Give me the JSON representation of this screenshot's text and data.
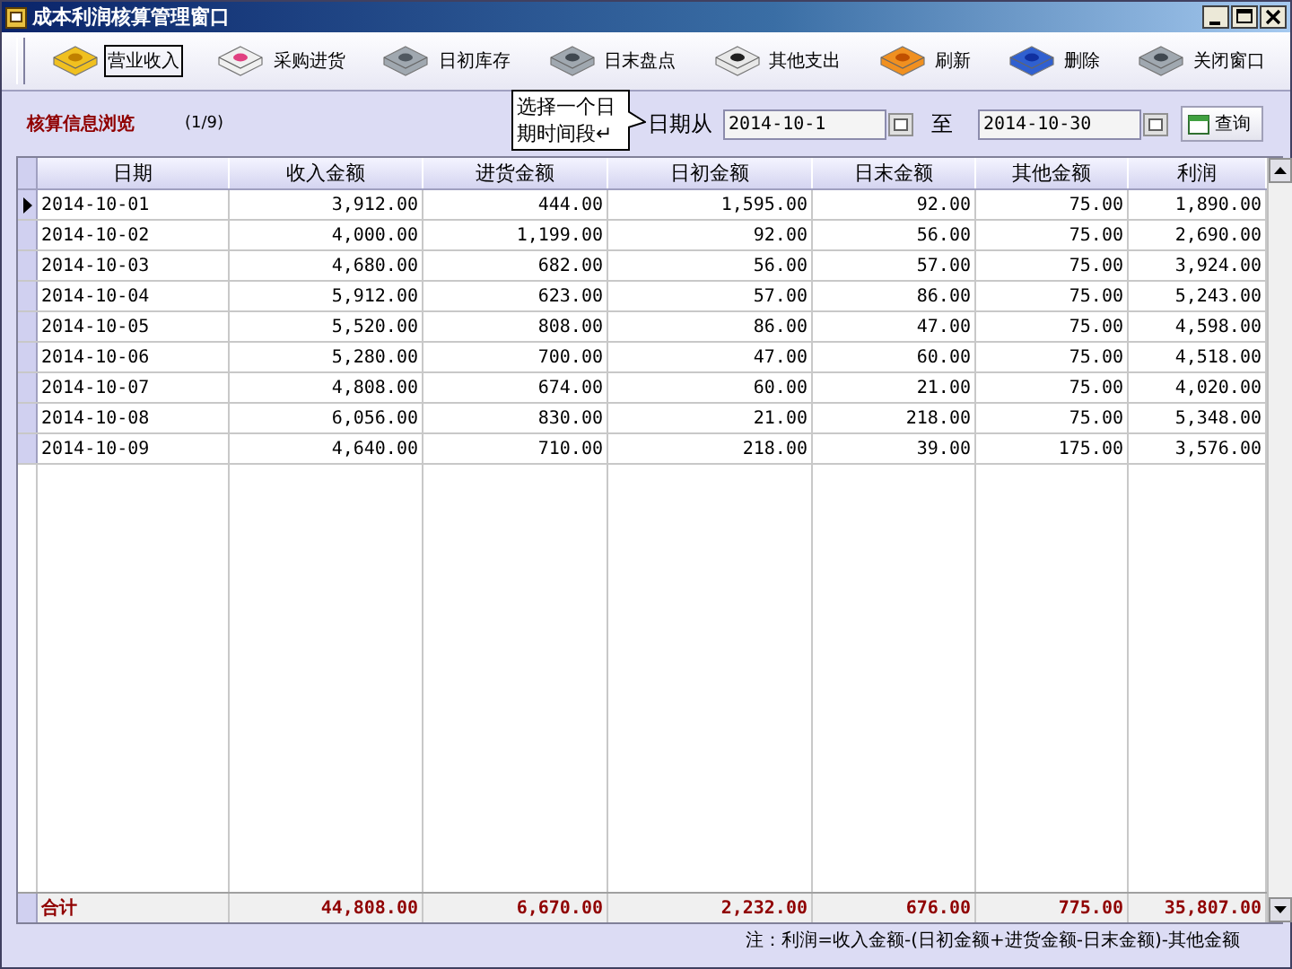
{
  "window": {
    "title": "成本利润核算管理窗口"
  },
  "toolbar": [
    {
      "label": "营业收入",
      "selected": true
    },
    {
      "label": "采购进货",
      "selected": false
    },
    {
      "label": "日初库存",
      "selected": false
    },
    {
      "label": "日末盘点",
      "selected": false
    },
    {
      "label": "其他支出",
      "selected": false
    },
    {
      "label": "刷新",
      "selected": false
    },
    {
      "label": "删除",
      "selected": false
    },
    {
      "label": "关闭窗口",
      "selected": false
    }
  ],
  "info_bar": {
    "title": "核算信息浏览",
    "page": "(1/9)",
    "callout": "选择一个日期时间段↵",
    "date_from_label": "日期从",
    "date_from": "2014-10-1",
    "date_to_label": "至",
    "date_to": "2014-10-30",
    "query_button": "查询"
  },
  "table": {
    "columns": [
      "日期",
      "收入金额",
      "进货金额",
      "日初金额",
      "日末金额",
      "其他金额",
      "利润"
    ],
    "rows": [
      {
        "selected": true,
        "cells": [
          "2014-10-01",
          "3,912.00",
          "444.00",
          "1,595.00",
          "92.00",
          "75.00",
          "1,890.00"
        ]
      },
      {
        "selected": false,
        "cells": [
          "2014-10-02",
          "4,000.00",
          "1,199.00",
          "92.00",
          "56.00",
          "75.00",
          "2,690.00"
        ]
      },
      {
        "selected": false,
        "cells": [
          "2014-10-03",
          "4,680.00",
          "682.00",
          "56.00",
          "57.00",
          "75.00",
          "3,924.00"
        ]
      },
      {
        "selected": false,
        "cells": [
          "2014-10-04",
          "5,912.00",
          "623.00",
          "57.00",
          "86.00",
          "75.00",
          "5,243.00"
        ]
      },
      {
        "selected": false,
        "cells": [
          "2014-10-05",
          "5,520.00",
          "808.00",
          "86.00",
          "47.00",
          "75.00",
          "4,598.00"
        ]
      },
      {
        "selected": false,
        "cells": [
          "2014-10-06",
          "5,280.00",
          "700.00",
          "47.00",
          "60.00",
          "75.00",
          "4,518.00"
        ]
      },
      {
        "selected": false,
        "cells": [
          "2014-10-07",
          "4,808.00",
          "674.00",
          "60.00",
          "21.00",
          "75.00",
          "4,020.00"
        ]
      },
      {
        "selected": false,
        "cells": [
          "2014-10-08",
          "6,056.00",
          "830.00",
          "21.00",
          "218.00",
          "75.00",
          "5,348.00"
        ]
      },
      {
        "selected": false,
        "cells": [
          "2014-10-09",
          "4,640.00",
          "710.00",
          "218.00",
          "39.00",
          "175.00",
          "3,576.00"
        ]
      }
    ],
    "totals": [
      "合计",
      "44,808.00",
      "6,670.00",
      "2,232.00",
      "676.00",
      "775.00",
      "35,807.00"
    ]
  },
  "note": "注：利润=收入金额-(日初金额+进货金额-日末金额)-其他金额"
}
